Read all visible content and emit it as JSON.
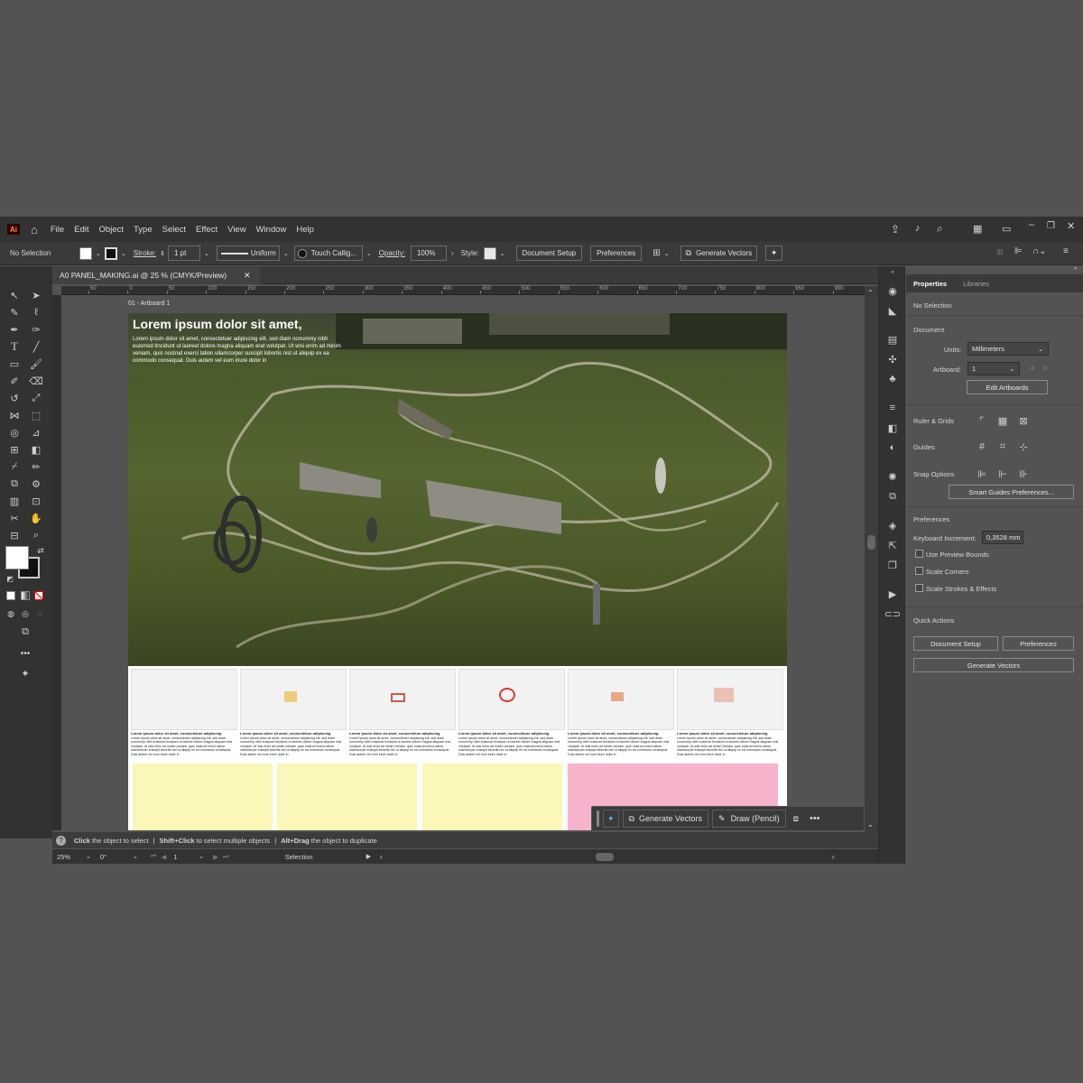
{
  "app": {
    "logo": "Ai"
  },
  "menu": [
    "File",
    "Edit",
    "Object",
    "Type",
    "Select",
    "Effect",
    "View",
    "Window",
    "Help"
  ],
  "control": {
    "selection": "No Selection",
    "stroke_label": "Stroke:",
    "stroke_value": "1 pt",
    "profile": "Uniform",
    "brush": "Touch Callig...",
    "opacity_label": "Opacity:",
    "opacity_value": "100%",
    "style_label": "Style:",
    "doc_setup": "Document Setup",
    "preferences": "Preferences",
    "generate_vectors": "Generate Vectors"
  },
  "document": {
    "tab_title": "A0 PANEL_MAKING.ai @ 25 % (CMYK/Preview)",
    "artboard_label": "01 - Artboard 1"
  },
  "ruler": {
    "ticks": [
      "50",
      "0",
      "50",
      "100",
      "150",
      "200",
      "250",
      "300",
      "350",
      "400",
      "450",
      "500",
      "550",
      "600",
      "650",
      "700",
      "750",
      "800",
      "850",
      "900"
    ]
  },
  "artwork": {
    "headline": "Lorem ipsum dolor sit amet,",
    "body": "Lorem ipsum dolor sit amet, consectetuer adipiscing elit, sed diam nonummy nibh euismod tincidunt ut laoreet dolore magna aliquam erat volutpat. Ut wisi enim ad minim veniam, quis nostrud exerci tation ullamcorper suscipit lobortis nisl ut aliquip ex ea commodo consequat. Duis autem vel eum iriure dolor in",
    "caption_title": "Lorem ipsum dolor sit amet, consectetuer adipiscing",
    "caption_body": "Lorem ipsum dolor sit amet, consectetuer adipiscing elit, sed diam nonummy nibh euismod tincidunt ut laoreet dolore magna aliquam erat volutpat. Ut wisi enim ad minim veniam, quis nostrud exerci tation ullamcorper suscipit lobortis nisl ut aliquip ex ea commodo consequat. Duis autem vel eum iriure dolor in"
  },
  "floating_bar": {
    "generate_vectors": "Generate Vectors",
    "draw": "Draw (Pencil)"
  },
  "status": {
    "hint1_bold": "Click",
    "hint1": " the object to select",
    "hint2_bold": "Shift+Click",
    "hint2": " to select multiple objects",
    "hint3_bold": "Alt+Drag",
    "hint3": " the object to duplicate",
    "zoom": "25%",
    "rotation": "0°",
    "artboard_num": "1",
    "mode": "Selection"
  },
  "panel": {
    "tab_properties": "Properties",
    "tab_libraries": "Libraries",
    "no_selection": "No Selection",
    "document_header": "Document",
    "units_label": "Units:",
    "units_value": "Millimeters",
    "artboard_label": "Artboard:",
    "artboard_value": "1",
    "edit_artboards": "Edit Artboards",
    "ruler_grids": "Ruler & Grids",
    "guides": "Guides",
    "snap_options": "Snap Options",
    "smart_guides": "Smart Guides Preferences...",
    "preferences_header": "Preferences",
    "keyboard_increment_label": "Keyboard Increment:",
    "keyboard_increment_value": "0,3528 mm",
    "use_preview_bounds": "Use Preview Bounds",
    "scale_corners": "Scale Corners",
    "scale_strokes": "Scale Strokes & Effects",
    "quick_actions": "Quick Actions",
    "qa_doc_setup": "Document Setup",
    "qa_preferences": "Preferences",
    "qa_generate": "Generate Vectors"
  }
}
